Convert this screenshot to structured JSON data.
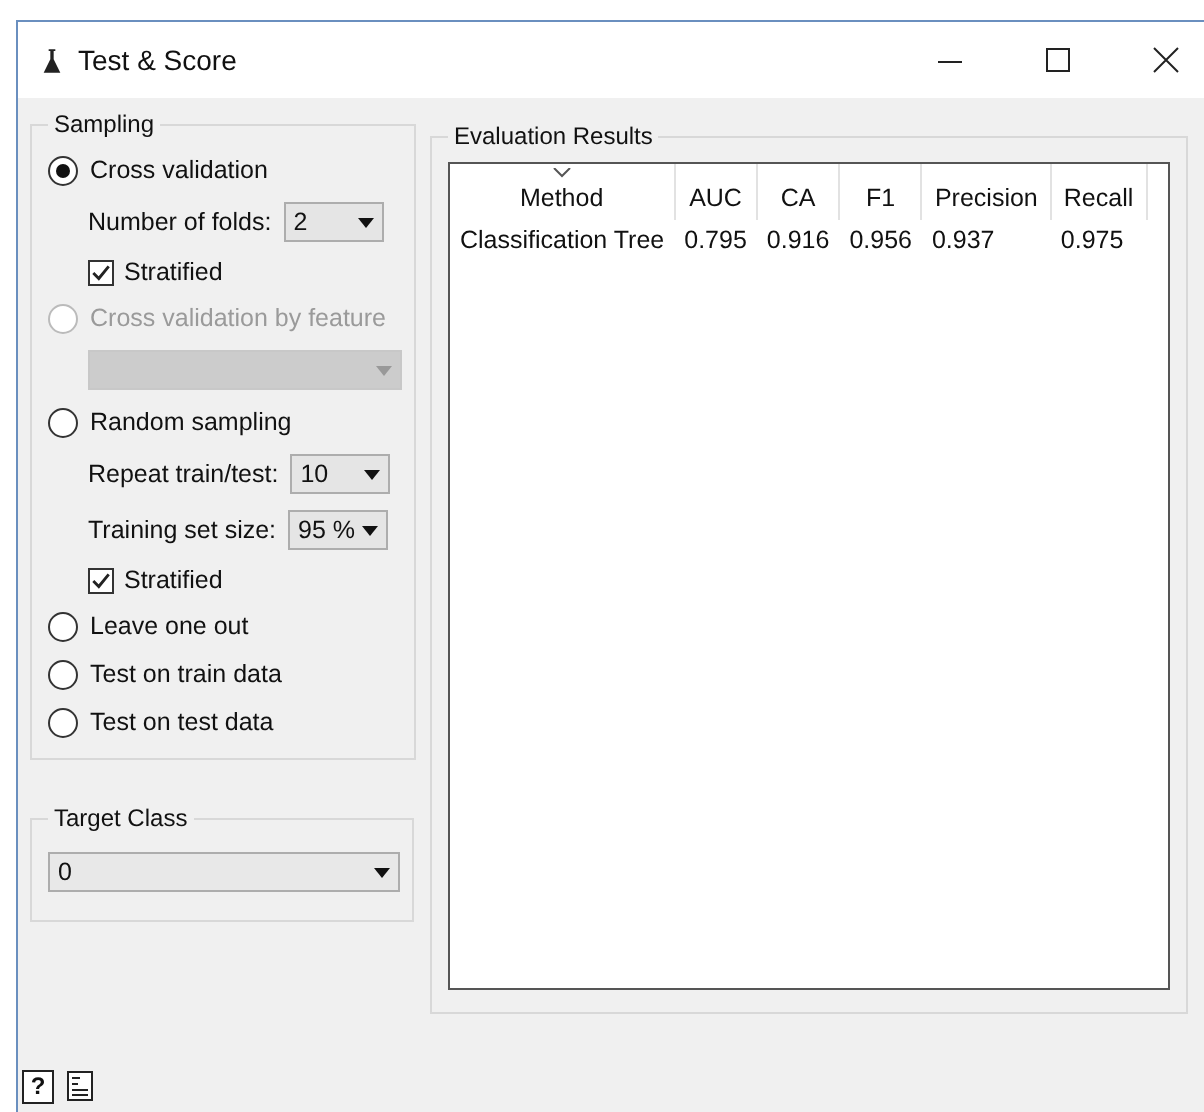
{
  "window": {
    "title": "Test & Score"
  },
  "sampling": {
    "title": "Sampling",
    "options": [
      {
        "label": "Cross validation",
        "selected": true,
        "disabled": false,
        "children": [
          {
            "kind": "dropdown",
            "label": "Number of folds:",
            "value": "2",
            "disabled": false
          },
          {
            "kind": "checkbox",
            "label": "Stratified",
            "checked": true
          }
        ]
      },
      {
        "label": "Cross validation by feature",
        "selected": false,
        "disabled": true,
        "children": [
          {
            "kind": "dropdown",
            "disabled": true
          }
        ]
      },
      {
        "label": "Random sampling",
        "selected": false,
        "disabled": false,
        "children": [
          {
            "kind": "dropdown",
            "label": "Repeat train/test:",
            "value": "10",
            "disabled": false
          },
          {
            "kind": "dropdown",
            "label": "Training set size:",
            "value": "95 %",
            "disabled": false
          },
          {
            "kind": "checkbox",
            "label": "Stratified",
            "checked": true
          }
        ]
      },
      {
        "label": "Leave one out",
        "selected": false,
        "disabled": false
      },
      {
        "label": "Test on train data",
        "selected": false,
        "disabled": false
      },
      {
        "label": "Test on test data",
        "selected": false,
        "disabled": false
      }
    ]
  },
  "target_class": {
    "title": "Target Class",
    "value": "0"
  },
  "evaluation": {
    "title": "Evaluation Results",
    "columns": [
      {
        "label": "Method",
        "sorted": true
      },
      {
        "label": "AUC",
        "sorted": false
      },
      {
        "label": "CA",
        "sorted": false
      },
      {
        "label": "F1",
        "sorted": false
      },
      {
        "label": "Precision",
        "sorted": false
      },
      {
        "label": "Recall",
        "sorted": false
      }
    ],
    "rows": [
      [
        "Classification Tree",
        "0.795",
        "0.916",
        "0.956",
        "0.937",
        "0.975"
      ]
    ]
  },
  "bottom_bar": {
    "help": "?"
  }
}
